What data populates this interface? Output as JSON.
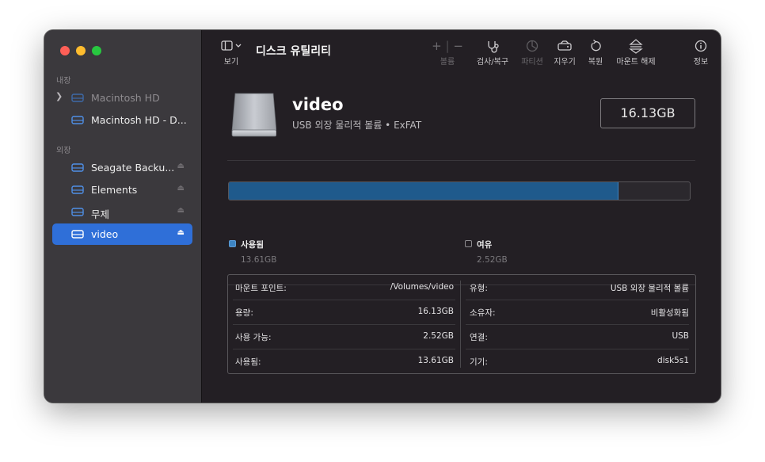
{
  "window": {
    "title": "디스크 유틸리티"
  },
  "sidebar": {
    "sections": [
      {
        "label": "내장",
        "items": [
          {
            "label": "Macintosh HD",
            "expandable": true,
            "dimmed": true
          },
          {
            "label": "Macintosh HD - D..."
          }
        ]
      },
      {
        "label": "외장",
        "items": [
          {
            "label": "Seagate Backu...",
            "ejectable": true
          },
          {
            "label": "Elements",
            "ejectable": true
          },
          {
            "label": "무제",
            "ejectable": true
          },
          {
            "label": "video",
            "ejectable": true,
            "selected": true
          }
        ]
      }
    ]
  },
  "toolbar": {
    "view_label": "보기",
    "volume_label": "볼륨",
    "first_aid_label": "검사/복구",
    "partition_label": "파티션",
    "erase_label": "지우기",
    "restore_label": "복원",
    "unmount_label": "마운트 해제",
    "info_label": "정보",
    "add_symbol": "+",
    "remove_symbol": "−"
  },
  "volume": {
    "name": "video",
    "description": "USB 외장 물리적 볼륨 • ExFAT",
    "capacity": "16.13GB"
  },
  "usage": {
    "used_fraction": 0.844,
    "used_label": "사용됨",
    "used_value": "13.61GB",
    "free_label": "여유",
    "free_value": "2.52GB",
    "used_color": "#1f5a8c",
    "free_color": "#2b282d"
  },
  "info": {
    "left": [
      {
        "key": "마운트 포인트:",
        "value": "/Volumes/video"
      },
      {
        "key": "용량:",
        "value": "16.13GB"
      },
      {
        "key": "사용 가능:",
        "value": "2.52GB"
      },
      {
        "key": "사용됨:",
        "value": "13.61GB"
      }
    ],
    "right": [
      {
        "key": "유형:",
        "value": "USB 외장 물리적 볼륨"
      },
      {
        "key": "소유자:",
        "value": "비활성화됨"
      },
      {
        "key": "연결:",
        "value": "USB"
      },
      {
        "key": "기기:",
        "value": "disk5s1"
      }
    ]
  },
  "colors": {
    "accent": "#2f6fd8",
    "sidebar_bg": "#3b393d",
    "content_bg": "#231f24"
  },
  "icons": {
    "sidebar_disk": "internal-disk-icon",
    "eject": "eject-icon",
    "volume": "external-drive-icon"
  }
}
